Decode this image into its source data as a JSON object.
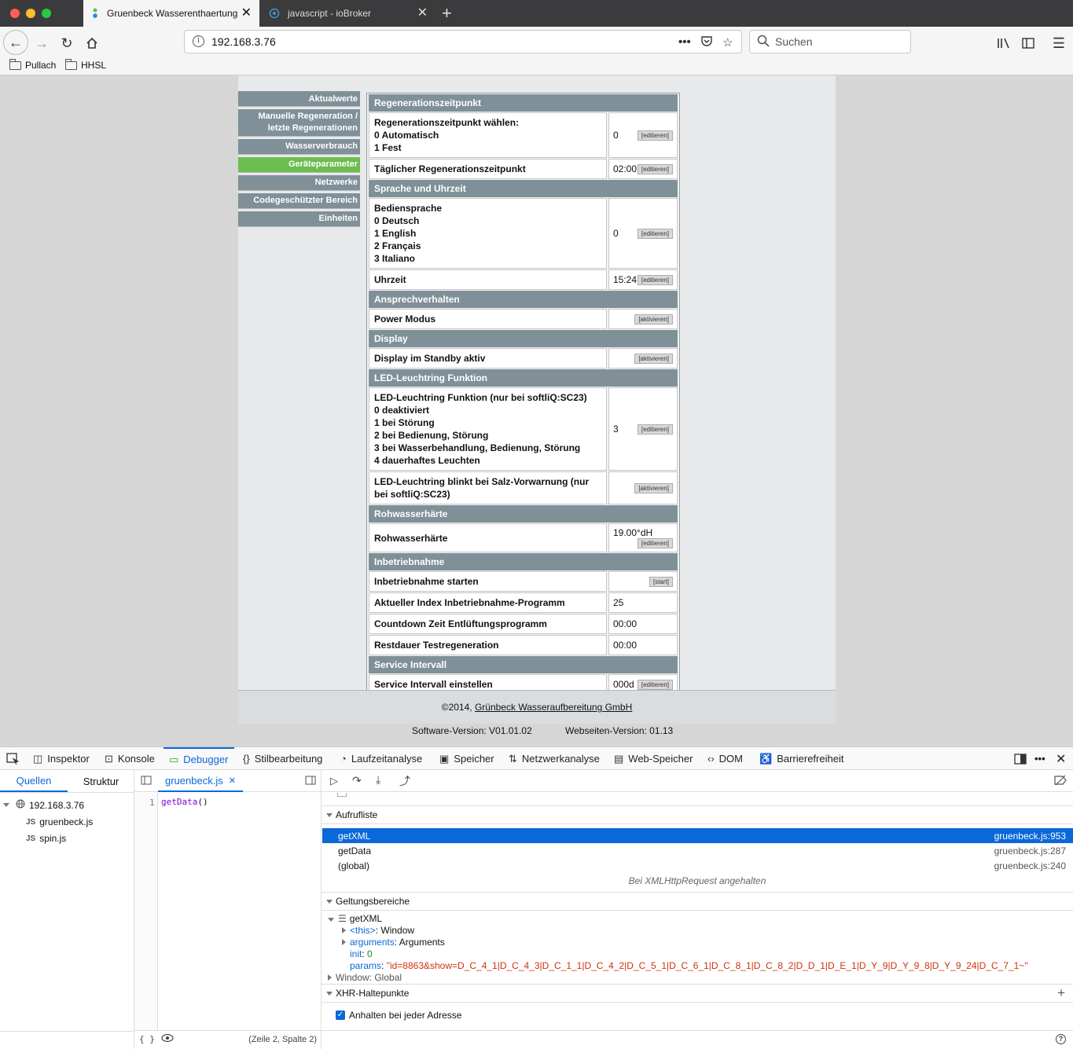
{
  "browser": {
    "tabs": [
      {
        "title": "Gruenbeck Wasserenthaertung",
        "active": true
      },
      {
        "title": "javascript - ioBroker",
        "active": false
      }
    ],
    "url": "192.168.3.76",
    "search_placeholder": "Suchen",
    "bookmarks": [
      "Pullach",
      "HHSL"
    ]
  },
  "page": {
    "menu": [
      "Aktualwerte",
      "Manuelle Regeneration / letzte Regenerationen",
      "Wasserverbrauch",
      "Geräteparameter",
      "Netzwerke",
      "Codegeschützter Bereich",
      "Einheiten"
    ],
    "active_menu": "Geräteparameter",
    "sections": [
      {
        "title": "Regenerationszeitpunkt",
        "rows": [
          {
            "label": [
              "Regenerationszeitpunkt wählen:",
              "0 Automatisch",
              "1 Fest"
            ],
            "value": "0",
            "button": "[editieren]"
          },
          {
            "label": [
              "Täglicher Regenerationszeitpunkt"
            ],
            "value": "02:00",
            "button": "[editieren]"
          }
        ]
      },
      {
        "title": "Sprache und Uhrzeit",
        "rows": [
          {
            "label": [
              "Bediensprache",
              "0 Deutsch",
              "1 English",
              "2 Français",
              "3 Italiano"
            ],
            "value": "0",
            "button": "[editieren]"
          },
          {
            "label": [
              "Uhrzeit"
            ],
            "value": "15:24",
            "button": "[editieren]"
          }
        ]
      },
      {
        "title": "Ansprechverhalten",
        "rows": [
          {
            "label": [
              "Power Modus"
            ],
            "value": "",
            "button": "[aktivieren]"
          }
        ]
      },
      {
        "title": "Display",
        "rows": [
          {
            "label": [
              "Display im Standby aktiv"
            ],
            "value": "",
            "button": "[aktivieren]"
          }
        ]
      },
      {
        "title": "LED-Leuchtring Funktion",
        "rows": [
          {
            "label": [
              "LED-Leuchtring Funktion (nur bei softliQ:SC23)",
              "0 deaktiviert",
              "1 bei Störung",
              "2 bei Bedienung, Störung",
              "3 bei Wasserbehandlung, Bedienung, Störung",
              "4 dauerhaftes Leuchten"
            ],
            "value": "3",
            "button": "[editieren]"
          },
          {
            "label": [
              "LED-Leuchtring blinkt bei Salz-Vorwarnung (nur bei softliQ:SC23)"
            ],
            "value": "",
            "button": "[aktivieren]"
          }
        ]
      },
      {
        "title": "Rohwasserhärte",
        "rows": [
          {
            "label": [
              "Rohwasserhärte"
            ],
            "value": "19.00°dH",
            "button": "[editieren]",
            "stack": true
          }
        ]
      },
      {
        "title": "Inbetriebnahme",
        "rows": [
          {
            "label": [
              "Inbetriebnahme starten"
            ],
            "value": "",
            "button": "[start]"
          },
          {
            "label": [
              "Aktueller Index Inbetriebnahme-Programm"
            ],
            "value": "25",
            "button": ""
          },
          {
            "label": [
              "Countdown Zeit Entlüftungsprogramm"
            ],
            "value": "00:00",
            "button": ""
          },
          {
            "label": [
              "Restdauer Testregeneration"
            ],
            "value": "00:00",
            "button": ""
          }
        ]
      },
      {
        "title": "Service Intervall",
        "rows": [
          {
            "label": [
              "Service Intervall einstellen"
            ],
            "value": "000d",
            "button": "[editieren]"
          }
        ]
      }
    ],
    "footer_prefix": "©2014, ",
    "footer_link": "Grünbeck Wasseraufbereitung GmbH",
    "software_version": "Software-Version: V01.01.02",
    "web_version": "Webseiten-Version: 01.13"
  },
  "devtools": {
    "tabs": [
      "Inspektor",
      "Konsole",
      "Debugger",
      "Stilbearbeitung",
      "Laufzeitanalyse",
      "Speicher",
      "Netzwerkanalyse",
      "Web-Speicher",
      "DOM",
      "Barrierefreiheit"
    ],
    "active_tab": "Debugger",
    "left": {
      "tab_sources": "Quellen",
      "tab_outline": "Struktur",
      "host": "192.168.3.76",
      "files": [
        "gruenbeck.js",
        "spin.js"
      ]
    },
    "editor": {
      "file_tab": "gruenbeck.js",
      "line_number": "1",
      "code_fn": "getData",
      "code_paren": "()",
      "cursor_pos": "(Zeile 2, Spalte 2)"
    },
    "callstack": {
      "title": "Aufrufliste",
      "frames": [
        {
          "name": "getXML",
          "loc": "gruenbeck.js:953",
          "selected": true
        },
        {
          "name": "getData",
          "loc": "gruenbeck.js:287",
          "selected": false
        },
        {
          "name": "(global)",
          "loc": "gruenbeck.js:240",
          "selected": false
        }
      ],
      "paused_reason": "Bei XMLHttpRequest angehalten"
    },
    "scopes": {
      "title": "Geltungsbereiche",
      "fn": "getXML",
      "this_key": "<this>",
      "this_val": "Window",
      "args_key": "arguments",
      "args_val": "Arguments",
      "init_key": "init",
      "init_val": "0",
      "params_key": "params",
      "params_val": "\"id=8863&show=D_C_4_1|D_C_4_3|D_C_1_1|D_C_4_2|D_C_5_1|D_C_6_1|D_C_8_1|D_C_8_2|D_D_1|D_E_1|D_Y_9|D_Y_9_8|D_Y_9_24|D_C_7_1~\"",
      "window": "Window: Global"
    },
    "xhr": {
      "title": "XHR-Haltepunkte",
      "item": "Anhalten bei jeder Adresse",
      "checked": true
    }
  },
  "colors": {
    "menu_bg": "#7f9098",
    "menu_active": "#6cbd4f",
    "selection": "#0a68d8"
  }
}
